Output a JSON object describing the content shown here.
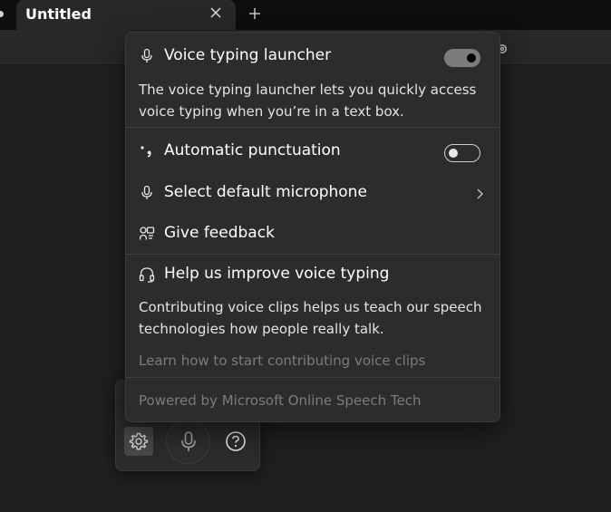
{
  "tab": {
    "title": "Untitled"
  },
  "flyout": {
    "launcher": {
      "label": "Voice typing launcher",
      "enabled": true,
      "description": "The voice typing launcher lets you quickly access voice typing when you’re in a text box."
    },
    "punctuation": {
      "label": "Automatic punctuation",
      "enabled": false
    },
    "microphone": {
      "label": "Select default microphone"
    },
    "feedback": {
      "label": "Give feedback"
    },
    "improve": {
      "label": "Help us improve voice typing",
      "description": "Contributing voice clips helps us teach our speech technologies how people really talk.",
      "link": "Learn how to start contributing voice clips"
    },
    "footer": "Powered by Microsoft Online Speech Tech"
  },
  "colors": {
    "background": "#202020",
    "flyout": "#2c2c2c",
    "toggle_on": "#7c7c7c",
    "muted_text": "#7c7c7c"
  }
}
